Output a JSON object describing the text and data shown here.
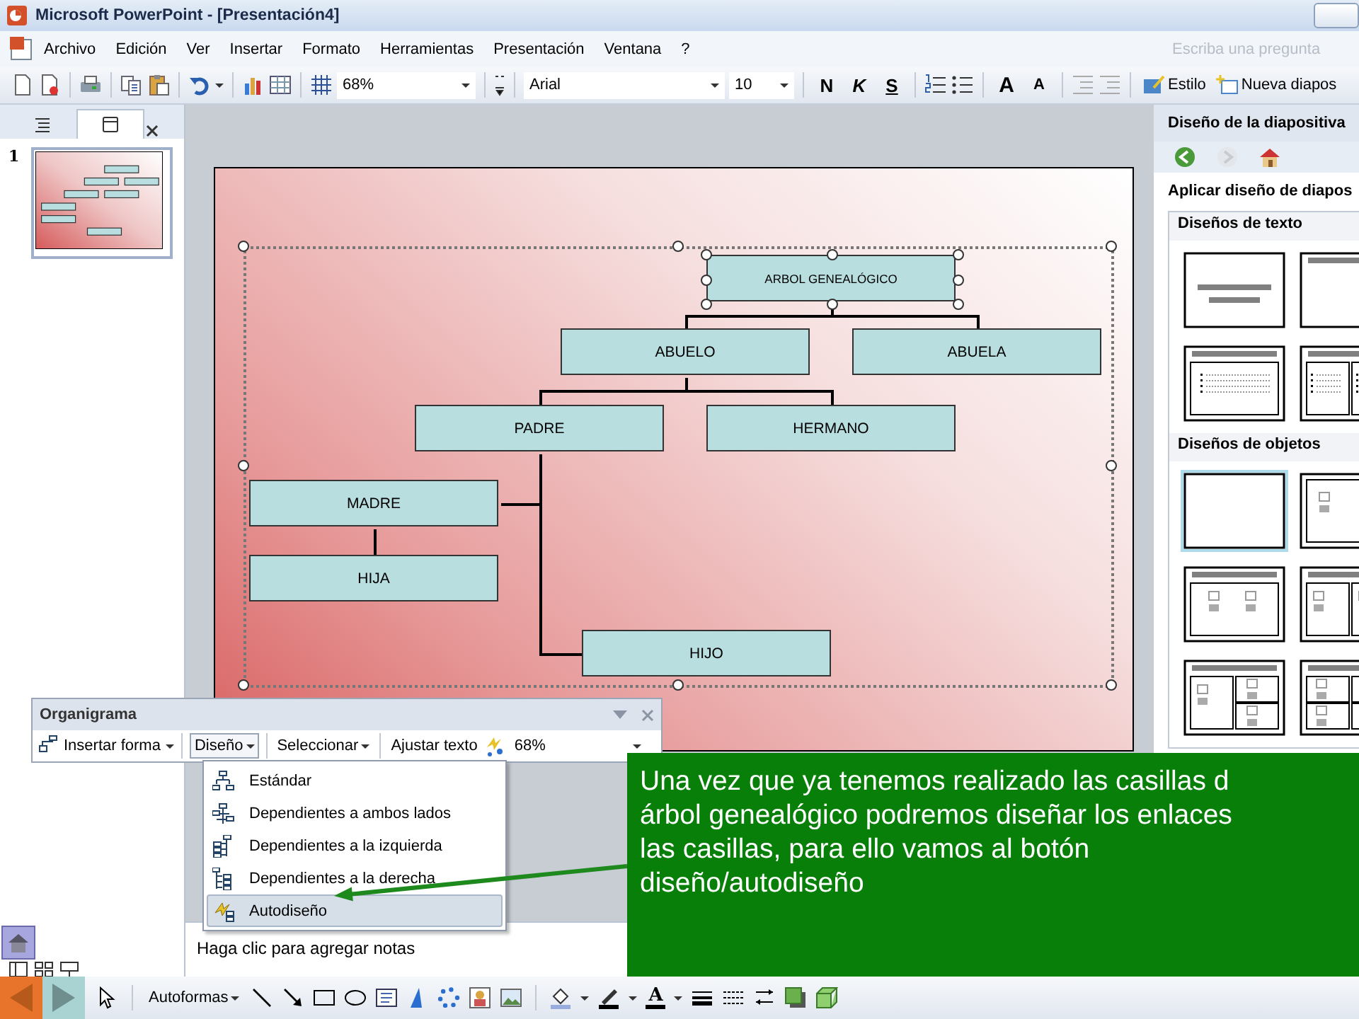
{
  "window": {
    "title": "Microsoft PowerPoint - [Presentación4]"
  },
  "menu": [
    {
      "label": "Archivo"
    },
    {
      "label": "Edición"
    },
    {
      "label": "Ver"
    },
    {
      "label": "Insertar"
    },
    {
      "label": "Formato"
    },
    {
      "label": "Herramientas"
    },
    {
      "label": "Presentación"
    },
    {
      "label": "Ventana"
    },
    {
      "label": "?"
    }
  ],
  "help_search": {
    "placeholder": "Escriba una pregunta"
  },
  "standard_toolbar": {
    "zoom": "68%",
    "font": "Arial",
    "font_size": "10",
    "bold": "N",
    "italic": "K",
    "underline": "S",
    "grow_font": "A",
    "shrink_font": "A",
    "style": "Estilo",
    "new_slide": "Nueva diapos"
  },
  "slides_pane": {
    "tabs": [
      {
        "kind": "outline",
        "selected": false
      },
      {
        "kind": "slides",
        "selected": true
      }
    ],
    "slides": [
      {
        "number": "1",
        "selected": true
      }
    ]
  },
  "slide": {
    "org_chart": {
      "selected": true,
      "root": {
        "label": "ARBOL GENEALÓGICO",
        "selected": true,
        "children": [
          {
            "label": "ABUELO",
            "selected": false,
            "children": [
              {
                "label": "PADRE",
                "selected": false,
                "children": [
                  {
                    "label": "MADRE",
                    "selected": false,
                    "children": [
                      {
                        "label": "HIJA",
                        "selected": false
                      }
                    ]
                  },
                  {
                    "label": "HIJO",
                    "selected": false
                  }
                ]
              },
              {
                "label": "HERMANO",
                "selected": false
              }
            ]
          },
          {
            "label": "ABUELA",
            "selected": false
          }
        ]
      }
    }
  },
  "notes": {
    "placeholder": "Haga clic para agregar notas"
  },
  "task_pane": {
    "title": "Diseño de la diapositiva",
    "heading": "Aplicar diseño de diapos",
    "sections": [
      {
        "title": "Diseños de texto",
        "layouts": [
          {
            "kind": "title",
            "selected": false
          },
          {
            "kind": "title_only",
            "selected": false
          },
          {
            "kind": "title_text",
            "selected": false
          },
          {
            "kind": "title_two_text",
            "selected": false
          }
        ]
      },
      {
        "title": "Diseños de objetos",
        "layouts": [
          {
            "kind": "blank",
            "selected": true
          },
          {
            "kind": "content",
            "selected": false
          },
          {
            "kind": "title_content",
            "selected": false
          },
          {
            "kind": "title_two_content",
            "selected": false
          },
          {
            "kind": "title_content_two",
            "selected": false
          },
          {
            "kind": "title_four_content",
            "selected": false
          }
        ]
      }
    ]
  },
  "org_toolbar": {
    "title": "Organigrama",
    "insert_shape": "Insertar forma",
    "layout": "Diseño",
    "select": "Seleccionar",
    "fit_text": "Ajustar texto",
    "zoom": "68%"
  },
  "layout_menu": [
    {
      "kind": "standard",
      "label": "Estándar",
      "selected": false
    },
    {
      "kind": "both",
      "label": "Dependientes a ambos lados",
      "selected": false
    },
    {
      "kind": "left",
      "label": "Dependientes a la izquierda",
      "selected": false
    },
    {
      "kind": "right",
      "label": "Dependientes a la derecha",
      "selected": false
    },
    {
      "kind": "auto",
      "label": "Autodiseño",
      "selected": true
    }
  ],
  "callout": {
    "text": "Una vez que ya tenemos realizado las casillas d\nárbol genealógico podremos diseñar los enlaces\nlas casillas, para ello vamos al botón\ndiseño/autodiseño"
  },
  "drawing_toolbar": {
    "autoshapes": "Autoformas",
    "font_color": "A"
  }
}
